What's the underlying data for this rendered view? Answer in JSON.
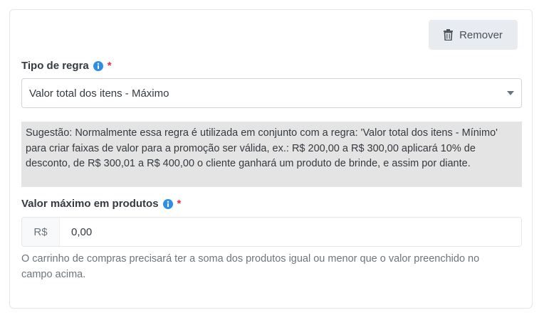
{
  "remove_button": {
    "label": "Remover",
    "icon": "trash-icon"
  },
  "rule_type": {
    "label": "Tipo de regra",
    "required_mark": "*",
    "selected": "Valor total dos itens - Máximo"
  },
  "suggestion": "Sugestão: Normalmente essa regra é utilizada em conjunto com a regra: 'Valor total dos itens - Mínimo' para criar faixas de valor para a promoção ser válida, ex.: R$ 200,00 a R$ 300,00 aplicará 10% de desconto, de R$ 300,01 a R$ 400,00 o cliente ganhará um produto de brinde, e assim por diante.",
  "max_value": {
    "label": "Valor máximo em produtos",
    "required_mark": "*",
    "currency": "R$",
    "value": "0,00",
    "help": "O carrinho de compras precisará ter a soma dos produtos igual ou menor que o valor preenchido no campo acima."
  },
  "colors": {
    "accent": "#2e8ee8",
    "required": "#dc3545",
    "suggestion_bg": "#e4e4e4"
  }
}
